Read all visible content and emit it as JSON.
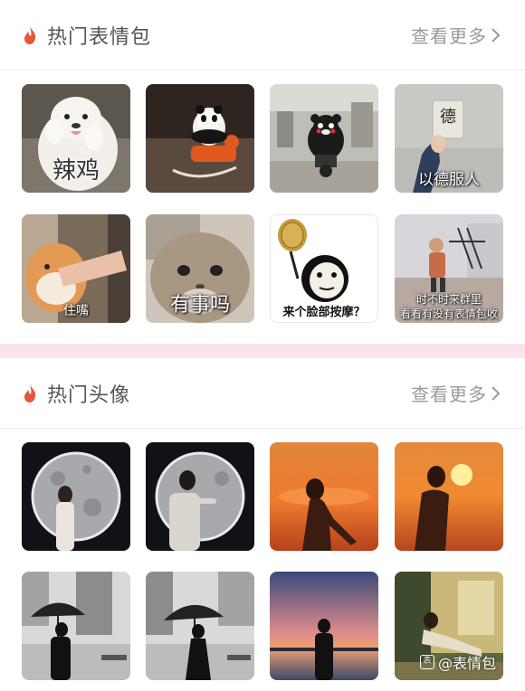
{
  "sections": {
    "emoji": {
      "title": "热门表情包",
      "more": "查看更多"
    },
    "avatar": {
      "title": "热门头像",
      "more": "查看更多"
    }
  },
  "emoji_items": [
    {
      "caption": "辣鸡"
    },
    {
      "caption": ""
    },
    {
      "caption": ""
    },
    {
      "caption": "以德服人",
      "sign": "德"
    },
    {
      "caption": "住嘴"
    },
    {
      "caption": "有事吗"
    },
    {
      "caption": "来个脸部按摩？"
    },
    {
      "caption_line1": "时不时来群里",
      "caption_line2": "看看有没有表情包收"
    }
  ],
  "watermark": {
    "text": "@表情包"
  },
  "colors": {
    "accent_pink": "#fbe3ec",
    "flame": "#e8553a"
  }
}
